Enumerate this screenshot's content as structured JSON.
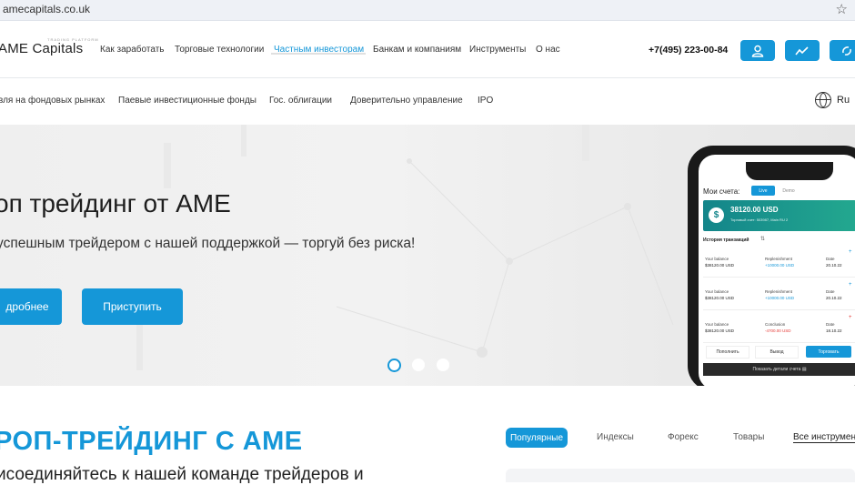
{
  "browser": {
    "url": "amecapitals.co.uk"
  },
  "header": {
    "logo": "AME Capitals",
    "logo_sub": "TRADING PLATFORM",
    "nav": [
      "Как заработать",
      "Торговые технологии",
      "Частным инвесторам",
      "Банкам и компаниям",
      "Инструменты",
      "О нас"
    ],
    "phone": "+7(495) 223-00-84"
  },
  "subnav": [
    "вля на фондовых рынках",
    "Паевые инвестиционные фонды",
    "Гос. облигации",
    "Доверительно управление",
    "IPO"
  ],
  "lang": "Ru",
  "hero": {
    "title": "оп трейдинг от AME",
    "subtitle": "успешным трейдером с нашей поддержкой — торгуй без риска!",
    "btn_more": "дробнее",
    "btn_start": "Приступить"
  },
  "app": {
    "accounts_label": "Мои счета:",
    "live": "Live",
    "demo": "Demo",
    "balance": "38120.00 USD",
    "account_line": "Торговый счет: 503987, Main RU 2",
    "history_title": "История транзакций",
    "rows": [
      {
        "col1": "Your balance",
        "val1": "$38120.00 USD",
        "col2": "Replenishment",
        "val2": "+10000.00 USD",
        "col3": "Date",
        "val3": "20.10.22"
      },
      {
        "col1": "Your balance",
        "val1": "$38120.00 USD",
        "col2": "Replenishment",
        "val2": "+10000.00 USD",
        "col3": "Date",
        "val3": "20.10.22"
      },
      {
        "col1": "Your balance",
        "val1": "$38120.00 USD",
        "col2": "Conclusion",
        "val2": "-4700.00 USD",
        "col3": "Date",
        "val3": "18.10.22"
      }
    ],
    "btn_deposit": "Пополнить",
    "btn_withdraw": "Вывод",
    "btn_trade": "Торговать",
    "details": "Показать детали счета"
  },
  "section": {
    "title": "РОП-ТРЕЙДИНГ С AME",
    "subtitle": "исоединяйтесь к нашей команде трейдеров и"
  },
  "tabs": [
    "Популярные",
    "Индексы",
    "Форекс",
    "Товары",
    "Все инструменты"
  ],
  "colors": {
    "accent": "#1597d8",
    "app_card": "#1a8f8f"
  }
}
